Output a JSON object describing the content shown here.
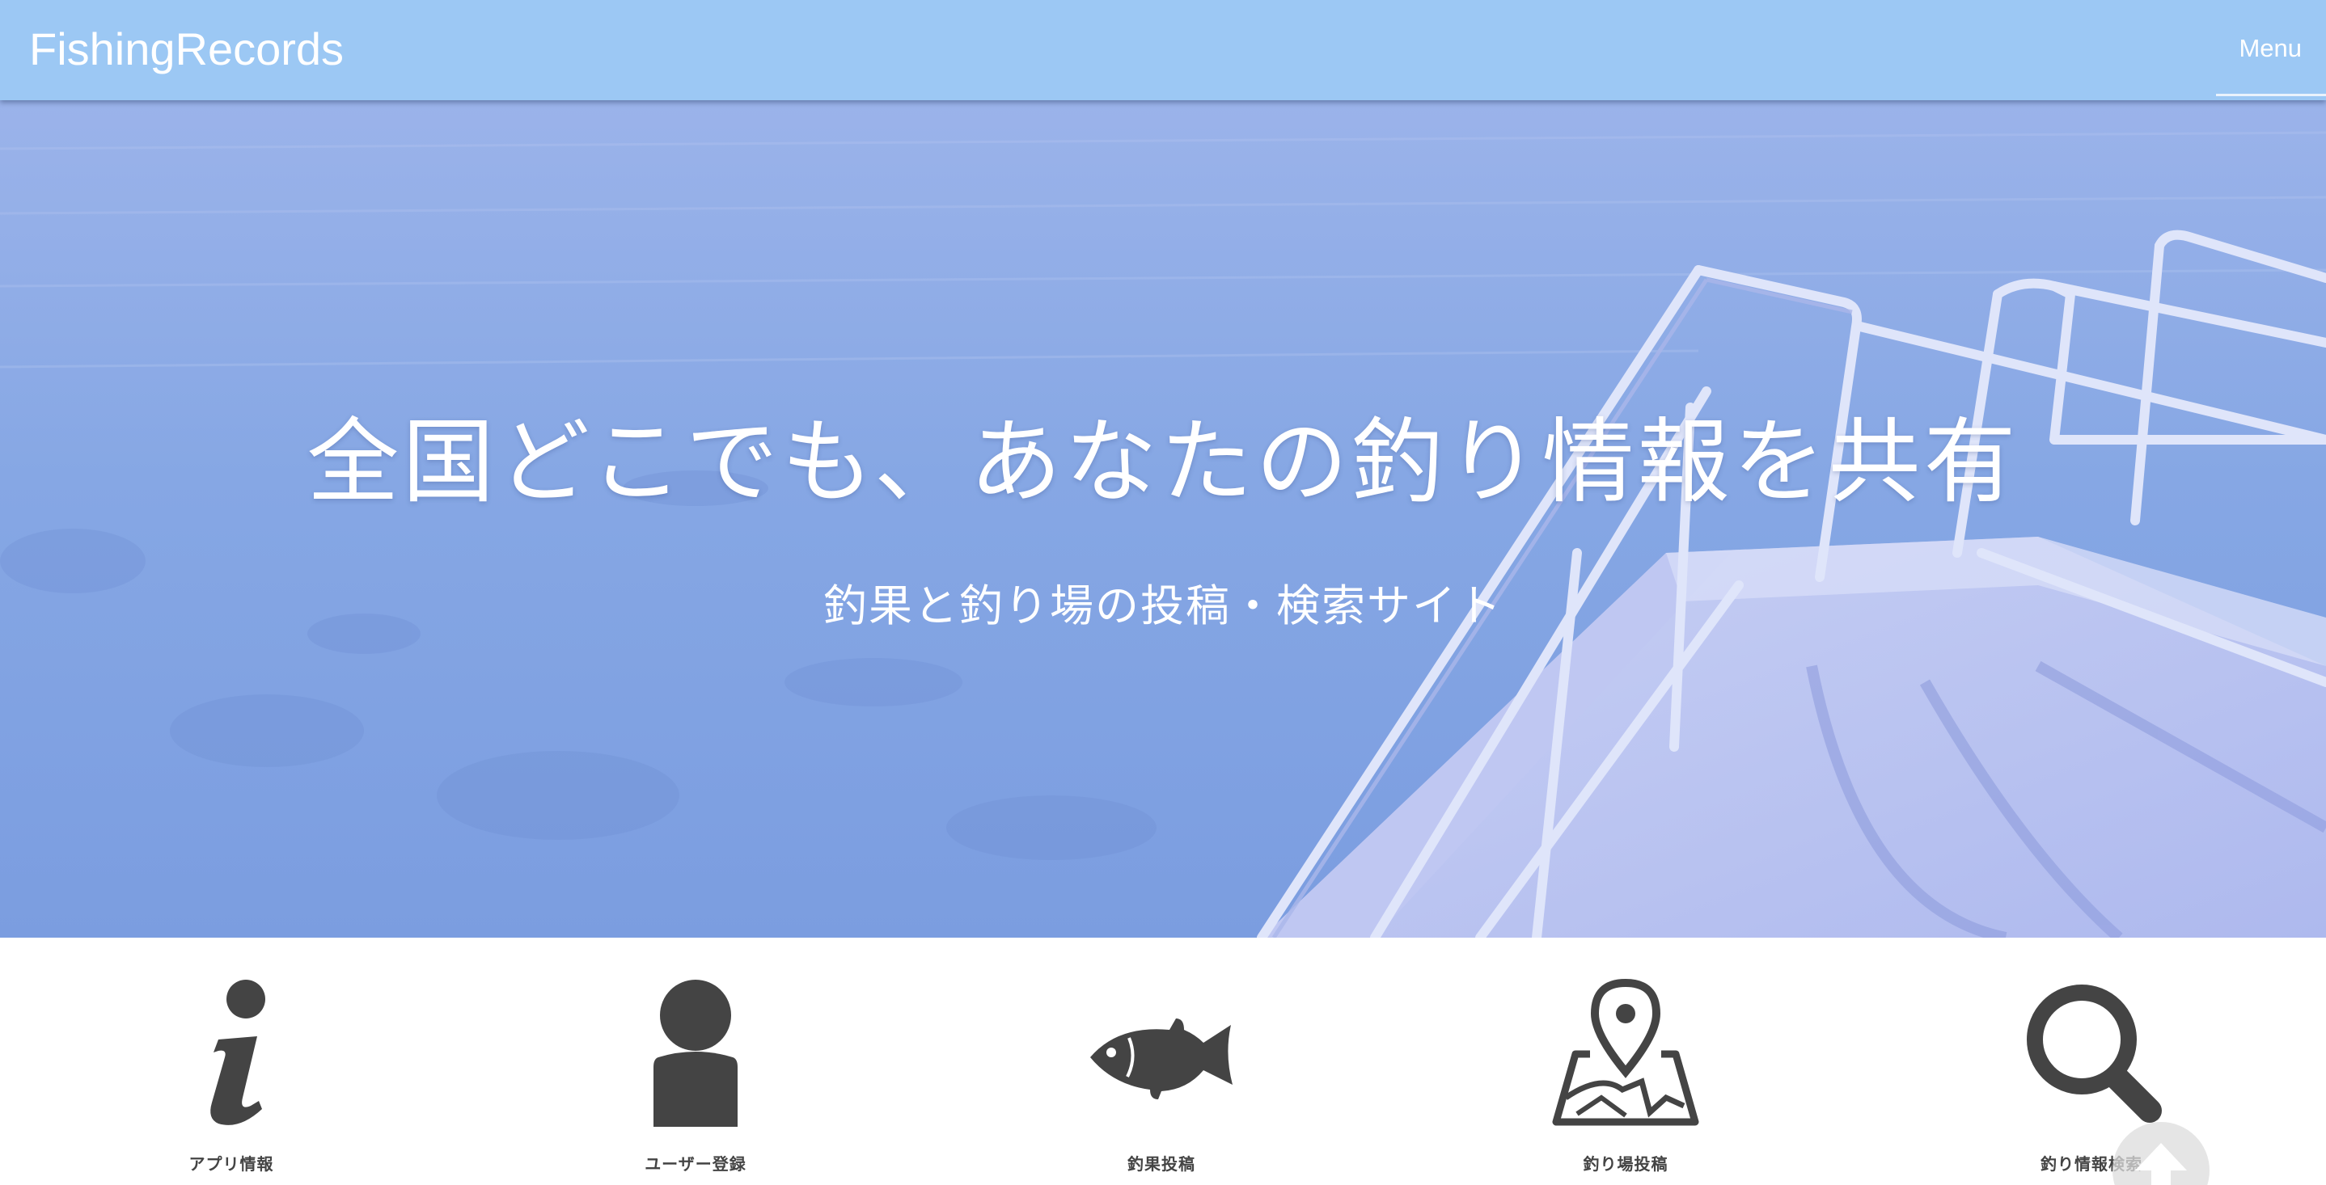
{
  "navbar": {
    "brand": "FishingRecords",
    "menu_label": "Menu",
    "background_color": "#9cc8f4"
  },
  "hero": {
    "title": "全国どこでも、あなたの釣り情報を共有",
    "subtitle": "釣果と釣り場の投稿・検索サイト",
    "image": "ocean-boat-bow-photo",
    "overlay_color": "#7f9fe6"
  },
  "features": [
    {
      "label": "アプリ情報",
      "icon": "info-icon"
    },
    {
      "label": "ユーザー登録",
      "icon": "user-icon"
    },
    {
      "label": "釣果投稿",
      "icon": "fish-icon"
    },
    {
      "label": "釣り場投稿",
      "icon": "map-pin-icon"
    },
    {
      "label": "釣り情報検索",
      "icon": "search-icon"
    }
  ],
  "scroll_top": {
    "icon": "arrow-up-icon"
  }
}
